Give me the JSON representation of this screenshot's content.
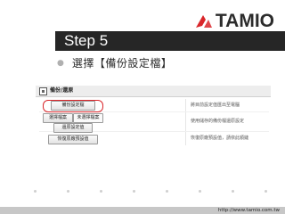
{
  "brand": {
    "logo_text": "TAMIO",
    "accent": "#d9262a"
  },
  "slide": {
    "title": "Step 5",
    "bullet": "選擇【備份設定檔】",
    "footer_url": "http://www.tamio.com.tw"
  },
  "dialog": {
    "header_title": "備份/還原",
    "buttons": {
      "backup_settings": "備份設定檔",
      "select_file": "選擇檔案",
      "no_file_chosen": "未選擇檔案",
      "restore_settings": "還原設定值",
      "restore_factory": "恢復原廠預設值"
    },
    "descriptions": {
      "backup": "將目前設定值匯出至電腦",
      "restore": "使用儲存的備份檔還原設定",
      "factory": "恢復原廠預設值，請依此順鏈"
    }
  }
}
